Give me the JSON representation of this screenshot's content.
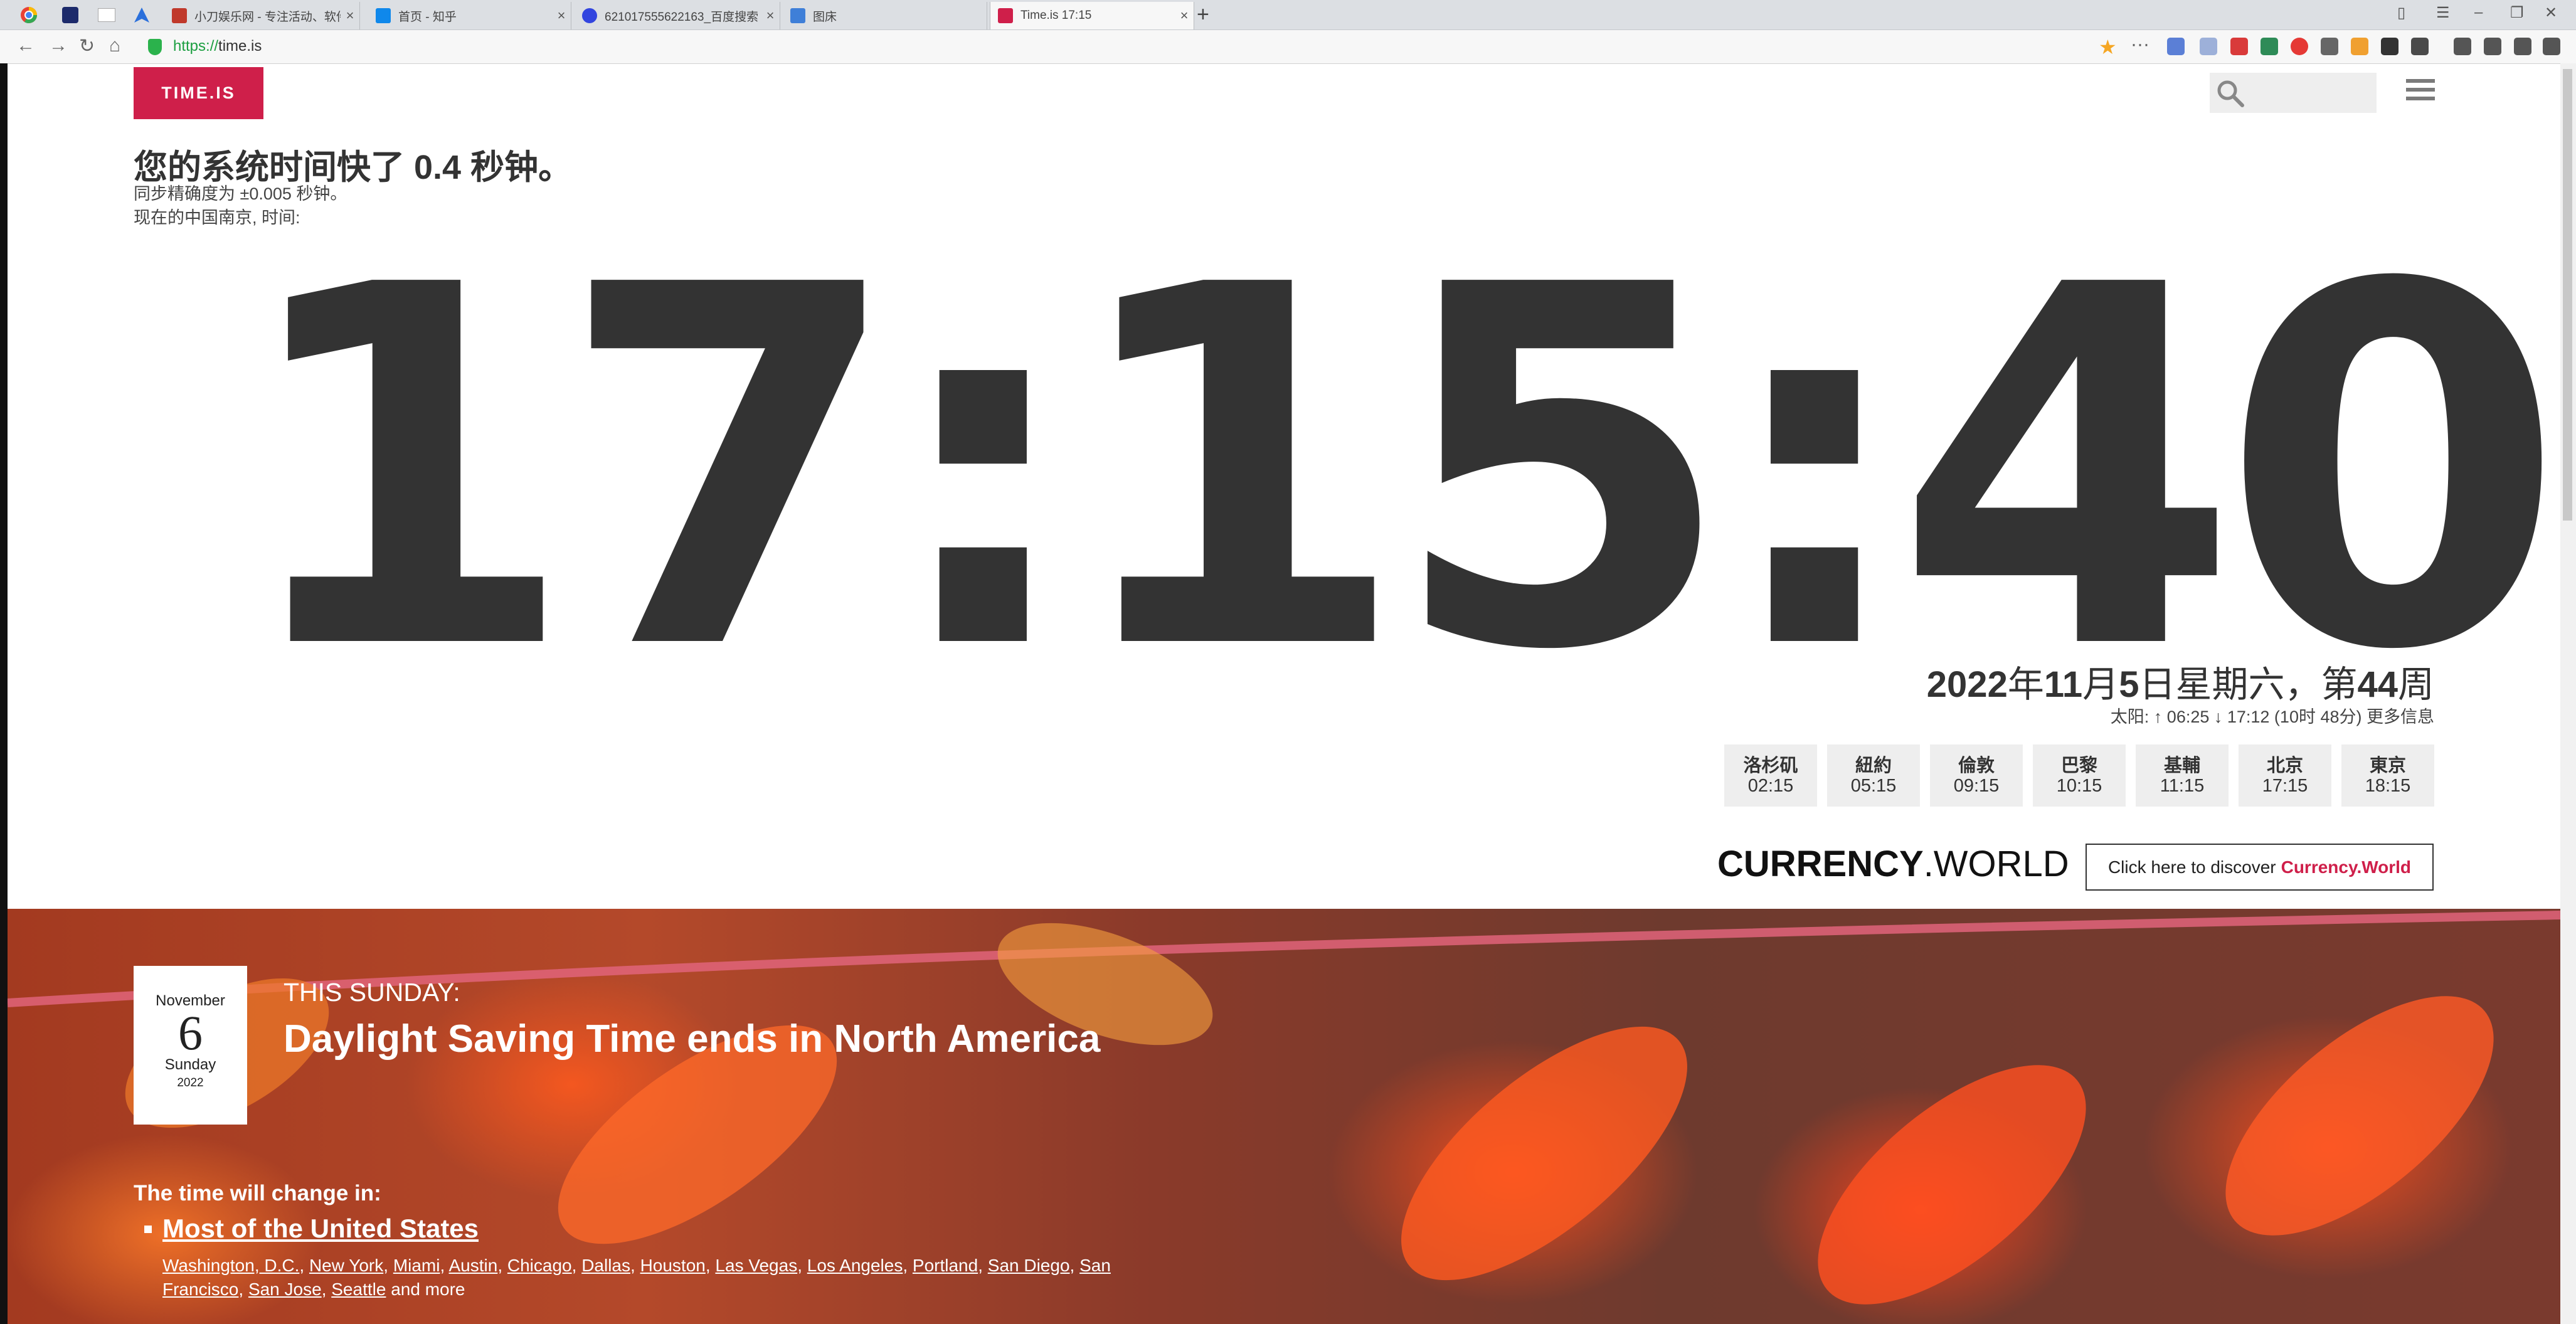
{
  "browser": {
    "tabs": [
      {
        "title": "小刀娱乐网 - 专注活动、软件",
        "favicon_color": "#c0392b"
      },
      {
        "title": "首页 - 知乎",
        "favicon_color": "#0f88eb"
      },
      {
        "title": "621017555622163_百度搜索",
        "favicon_color": "#3245df"
      },
      {
        "title": "图床",
        "favicon_color": "#3f7fd8"
      },
      {
        "title": "Time.is 17:15",
        "favicon_color": "#cf1f4a",
        "active": true
      }
    ],
    "new_tab_label": "+",
    "url_scheme": "https://",
    "url_host": "time.is"
  },
  "page": {
    "logo": "TIME.IS",
    "headline": "您的系统时间快了 0.4 秒钟。",
    "sync_accuracy": "同步精确度为 ±0.005 秒钟。",
    "location_line": "现在的中国南京, 时间:",
    "clock": "17:15:40",
    "date": {
      "year": "2022",
      "y_suffix": "年",
      "month": "11",
      "m_suffix": "月",
      "day": "5",
      "d_suffix": "日星期六，第",
      "week": "44",
      "w_suffix": "周"
    },
    "sun_info": "太阳: ↑ 06:25 ↓ 17:12 (10时 48分) 更多信息",
    "cities": [
      {
        "name": "洛杉矶",
        "time": "02:15"
      },
      {
        "name": "紐約",
        "time": "05:15"
      },
      {
        "name": "倫敦",
        "time": "09:15"
      },
      {
        "name": "巴黎",
        "time": "10:15"
      },
      {
        "name": "基輔",
        "time": "11:15"
      },
      {
        "name": "北京",
        "time": "17:15"
      },
      {
        "name": "東京",
        "time": "18:15"
      }
    ],
    "currency_world": {
      "logo_bold": "CURRENCY",
      "logo_rest": ".WORLD",
      "button_text": "Click here to discover",
      "button_link": "Currency.World"
    }
  },
  "banner": {
    "calendar": {
      "month": "November",
      "day": "6",
      "weekday": "Sunday",
      "year": "2022"
    },
    "this_day": "THIS SUNDAY:",
    "event": "Daylight Saving Time ends in North America",
    "will_change": "The time will change in:",
    "region": "Most of the United States",
    "city_links": [
      "Washington, D.C.",
      "New York",
      "Miami",
      "Austin",
      "Chicago",
      "Dallas",
      "Houston",
      "Las Vegas",
      "Los Angeles",
      "Portland",
      "San Diego",
      "San Francisco",
      "San Jose",
      "Seattle"
    ],
    "and_more": "and more"
  }
}
